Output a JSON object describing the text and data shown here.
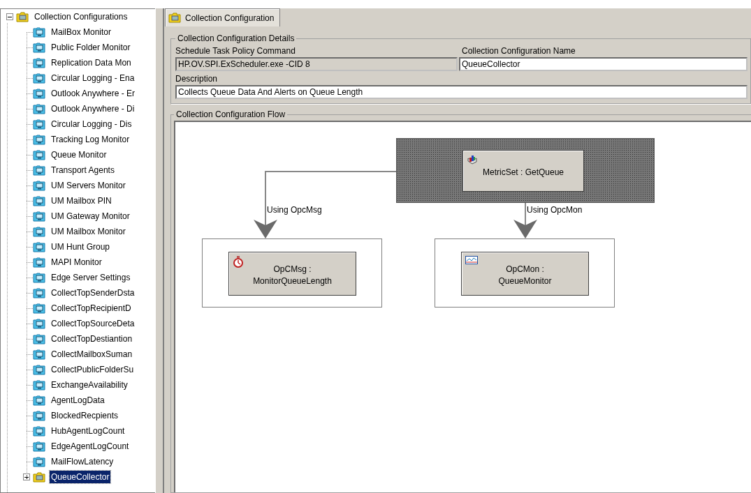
{
  "tree": {
    "items": [
      {
        "label": "Collection Configurations",
        "kind": "group",
        "expanded": true,
        "selected": false,
        "children": [
          {
            "label": "MailBox Monitor",
            "kind": "config",
            "selected": false
          },
          {
            "label": "Public Folder Monitor",
            "kind": "config",
            "selected": false
          },
          {
            "label": "Replication Data Mon",
            "kind": "config",
            "selected": false
          },
          {
            "label": "Circular Logging - Ena",
            "kind": "config",
            "selected": false
          },
          {
            "label": "Outlook Anywhere - Er",
            "kind": "config",
            "selected": false
          },
          {
            "label": "Outlook Anywhere - Di",
            "kind": "config",
            "selected": false
          },
          {
            "label": "Circular Logging - Dis",
            "kind": "config",
            "selected": false
          },
          {
            "label": "Tracking Log Monitor",
            "kind": "config",
            "selected": false
          },
          {
            "label": "Queue Monitor",
            "kind": "config",
            "selected": false
          },
          {
            "label": "Transport Agents",
            "kind": "config",
            "selected": false
          },
          {
            "label": "UM Servers Monitor",
            "kind": "config",
            "selected": false
          },
          {
            "label": "UM Mailbox PIN",
            "kind": "config",
            "selected": false
          },
          {
            "label": "UM Gateway Monitor",
            "kind": "config",
            "selected": false
          },
          {
            "label": "UM Mailbox Monitor",
            "kind": "config",
            "selected": false
          },
          {
            "label": "UM Hunt Group",
            "kind": "config",
            "selected": false
          },
          {
            "label": "MAPI Monitor",
            "kind": "config",
            "selected": false
          },
          {
            "label": "Edge Server Settings",
            "kind": "config",
            "selected": false
          },
          {
            "label": "CollectTopSenderDsta",
            "kind": "config",
            "selected": false
          },
          {
            "label": "CollectTopRecipientD",
            "kind": "config",
            "selected": false
          },
          {
            "label": "CollectTopSourceDeta",
            "kind": "config",
            "selected": false
          },
          {
            "label": "CollectTopDestiantion",
            "kind": "config",
            "selected": false
          },
          {
            "label": "CollectMailboxSuman",
            "kind": "config",
            "selected": false
          },
          {
            "label": "CollectPublicFolderSu",
            "kind": "config",
            "selected": false
          },
          {
            "label": "ExchangeAvailability",
            "kind": "config",
            "selected": false
          },
          {
            "label": "AgentLogData",
            "kind": "config",
            "selected": false
          },
          {
            "label": "BlockedRecpients",
            "kind": "config",
            "selected": false
          },
          {
            "label": "HubAgentLogCount",
            "kind": "config",
            "selected": false
          },
          {
            "label": "EdgeAgentLogCount",
            "kind": "config",
            "selected": false
          },
          {
            "label": "MailFlowLatency",
            "kind": "config",
            "selected": false
          },
          {
            "label": "QueueCollector",
            "kind": "group",
            "expanded": false,
            "selected": true
          }
        ]
      }
    ]
  },
  "tabs": [
    {
      "label": "Collection Configuration",
      "selected": true
    }
  ],
  "details": {
    "title": "Collection Configuration Details",
    "command_label": "Schedule Task Policy Command",
    "command": {
      "value": "HP.OV.SPI.ExScheduler.exe -CID 8",
      "disabled": true
    },
    "name_label": "Collection Configuration Name",
    "name": {
      "value": "QueueCollector",
      "disabled": false
    },
    "description_label": "Description",
    "description": {
      "value": "Collects Queue Data And Alerts on Queue Length",
      "disabled": false
    }
  },
  "flow": {
    "title": "Collection Configuration Flow",
    "nodes": [
      {
        "kind": "metricset",
        "label": "MetricSet : GetQueue",
        "selected": true
      },
      {
        "kind": "opcmsg",
        "label": "OpCMsg :\nMonitorQueueLength",
        "selected": false
      },
      {
        "kind": "opcmon",
        "label": "OpCMon :\nQueueMonitor",
        "selected": false
      }
    ],
    "edges": [
      {
        "label": "Using OpcMsg"
      },
      {
        "label": "Using OpcMon"
      }
    ]
  }
}
